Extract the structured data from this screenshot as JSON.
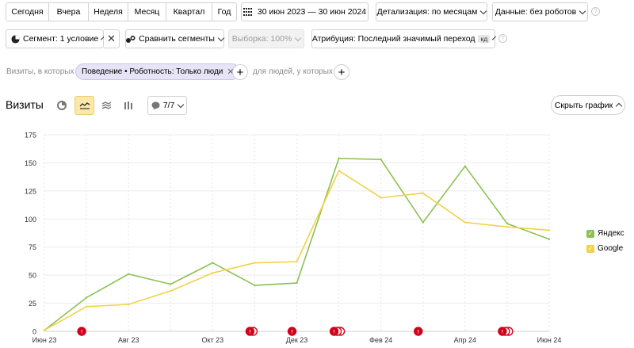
{
  "toolbar": {
    "periods": [
      "Сегодня",
      "Вчера",
      "Неделя",
      "Месяц",
      "Квартал",
      "Год"
    ],
    "date_range": "30 июн 2023 — 30 июн 2024",
    "detail": "Детализация: по месяцам",
    "data_filter": "Данные: без роботов"
  },
  "segment_bar": {
    "segment": "Сегмент: 1 условие",
    "compare": "Сравнить сегменты",
    "sample": "Выборка: 100%",
    "attribution": "Атрибуция: Последний значимый переход",
    "attribution_badge": "кд"
  },
  "filters": {
    "visits_label": "Визиты, в которых",
    "chip": "Поведение • Роботность: Только люди",
    "people_label": "для людей, у которых"
  },
  "chart_header": {
    "title": "Визиты",
    "series_count": "7/7",
    "hide_button": "Скрыть график"
  },
  "colors": {
    "yandex": "#8cc152",
    "google": "#f2d24a",
    "accent_bg": "#fce8a8",
    "chip_bg": "#e6e4f6",
    "marker": "#d0021b"
  },
  "icons": [
    "calendar-icon",
    "pie-icon",
    "compare-icon",
    "pie-small-icon",
    "line-chart-icon",
    "area-chart-icon",
    "bar-chart-icon",
    "comment-icon"
  ],
  "chart_data": {
    "type": "line",
    "categories": [
      "Июн 23",
      "Июл 23",
      "Авг 23",
      "Сен 23",
      "Окт 23",
      "Ноя 23",
      "Дек 23",
      "Янв 24",
      "Фев 24",
      "Мар 24",
      "Апр 24",
      "Май 24",
      "Июн 24"
    ],
    "x_tick_labels": [
      "Июн 23",
      "Авг 23",
      "Окт 23",
      "Дек 23",
      "Фев 24",
      "Апр 24",
      "Июн 24"
    ],
    "y_ticks": [
      0,
      25,
      50,
      75,
      100,
      125,
      150,
      175
    ],
    "ylim": [
      0,
      175
    ],
    "grid": true,
    "legend_position": "right",
    "series": [
      {
        "name": "Яндекс",
        "color": "#8cc152",
        "values": [
          1,
          30,
          51,
          42,
          61,
          41,
          43,
          154,
          153,
          97,
          147,
          96,
          82
        ]
      },
      {
        "name": "Google",
        "color": "#f2d24a",
        "values": [
          1,
          22,
          24,
          36,
          52,
          61,
          62,
          143,
          119,
          123,
          97,
          93,
          90
        ]
      }
    ],
    "annotation_markers": [
      {
        "x": "Июл 23",
        "count": 1
      },
      {
        "x": "Ноя 23",
        "count": 2
      },
      {
        "x": "Дек 23",
        "count": 1
      },
      {
        "x": "Янв 24",
        "count": 3
      },
      {
        "x": "Мар 24",
        "count": 1
      },
      {
        "x": "Май 24",
        "count": 3
      }
    ]
  }
}
